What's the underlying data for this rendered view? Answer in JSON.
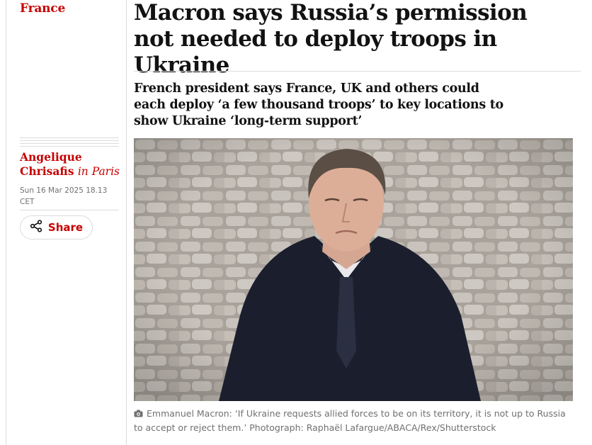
{
  "section": {
    "label": "France"
  },
  "article": {
    "headline": "Macron says Russia’s permission not needed to deploy troops in Ukraine",
    "standfirst": "French president says France, UK and others could each deploy ‘a few thousand troops’ to key locations to show Ukraine ‘long-term support’"
  },
  "byline": {
    "author": "Angelique Chrisafis",
    "location": "in Paris"
  },
  "dateline": {
    "text": "Sun 16 Mar 2025 18.13 CET"
  },
  "share": {
    "label": "Share",
    "icon": "share-icon"
  },
  "photo": {
    "description_icon": "camera-icon"
  },
  "caption": {
    "text": "Emmanuel Macron: ‘If Ukraine requests allied forces to be on its territory, it is not up to Russia to accept or reject them.’ Photograph: Raphaël Lafargue/ABACA/Rex/Shutterstock"
  },
  "colors": {
    "accent": "#c70000",
    "text": "#121212",
    "muted": "#707070",
    "rule": "#dcdcdc"
  }
}
